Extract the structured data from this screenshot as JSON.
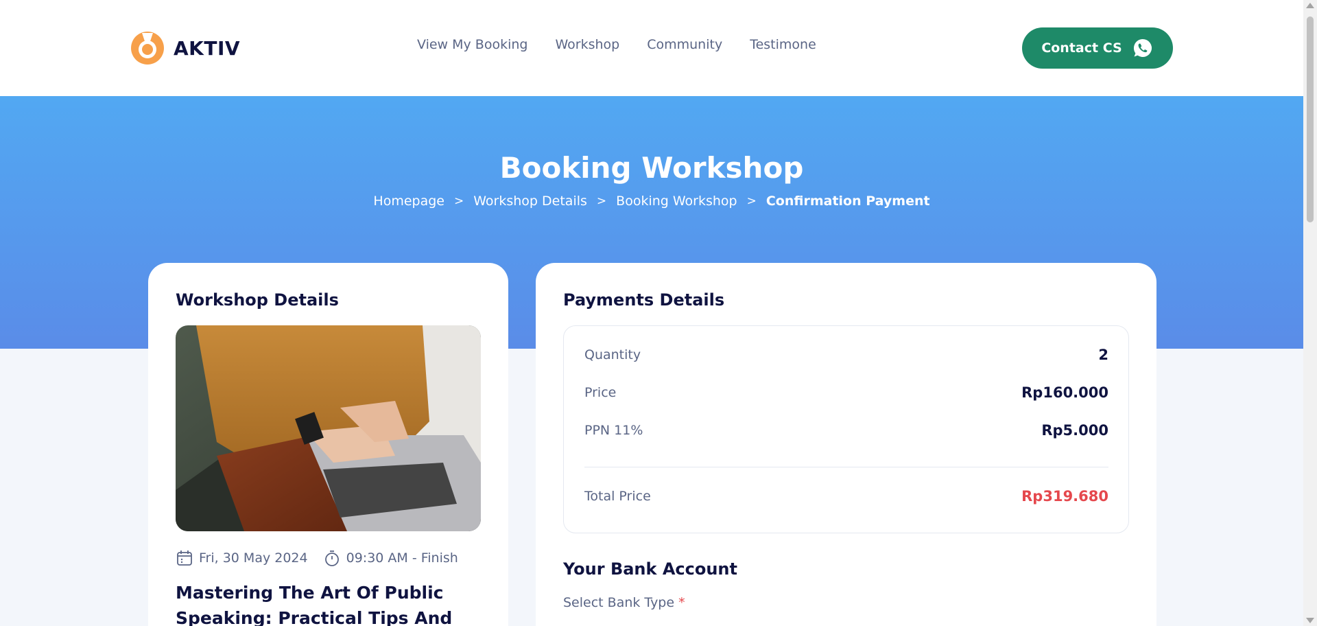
{
  "brand": {
    "name": "AKTIV",
    "logo_icon": "aktiv-logo-icon",
    "logo_color": "#F7A04A"
  },
  "nav": {
    "links": [
      {
        "label": "View My Booking"
      },
      {
        "label": "Workshop"
      },
      {
        "label": "Community"
      },
      {
        "label": "Testimone"
      }
    ],
    "contact_button": {
      "label": "Contact CS",
      "icon": "whatsapp-icon",
      "color": "#1E8A68"
    }
  },
  "hero": {
    "title": "Booking Workshop",
    "breadcrumb": [
      {
        "label": "Homepage"
      },
      {
        "label": "Workshop Details"
      },
      {
        "label": "Booking Workshop"
      },
      {
        "label": "Confirmation Payment"
      }
    ],
    "separator": ">",
    "gradient": [
      "#52A8F2",
      "#5A8CE8"
    ]
  },
  "workshop": {
    "section_title": "Workshop Details",
    "image": "laptop-photo",
    "date": "Fri, 30 May 2024",
    "date_icon": "calendar-icon",
    "time": "09:30 AM - Finish",
    "time_icon": "stopwatch-icon",
    "name": "Mastering The Art Of Public Speaking: Practical Tips And"
  },
  "payment": {
    "section_title": "Payments Details",
    "rows": [
      {
        "label": "Quantity",
        "value": "2"
      },
      {
        "label": "Price",
        "value": "Rp160.000"
      },
      {
        "label": "PPN 11%",
        "value": "Rp5.000"
      }
    ],
    "total": {
      "label": "Total Price",
      "value": "Rp319.680",
      "color": "#E5484D"
    }
  },
  "bank": {
    "section_title": "Your Bank Account",
    "select_label": "Select Bank Type",
    "required_mark": "*"
  }
}
